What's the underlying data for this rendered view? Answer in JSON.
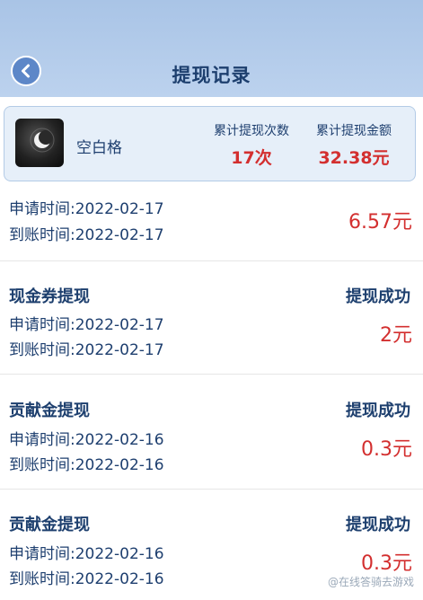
{
  "header": {
    "title": "提现记录"
  },
  "summary": {
    "username": "空白格",
    "count_label": "累计提现次数",
    "count_value": "17次",
    "amount_label": "累计提现金额",
    "amount_value": "32.38元"
  },
  "records": [
    {
      "type": "",
      "status": "",
      "apply": "申请时间:2022-02-17",
      "arrive": "到账时间:2022-02-17",
      "amount": "6.57元"
    },
    {
      "type": "现金券提现",
      "status": "提现成功",
      "apply": "申请时间:2022-02-17",
      "arrive": "到账时间:2022-02-17",
      "amount": "2元"
    },
    {
      "type": "贡献金提现",
      "status": "提现成功",
      "apply": "申请时间:2022-02-16",
      "arrive": "到账时间:2022-02-16",
      "amount": "0.3元"
    },
    {
      "type": "贡献金提现",
      "status": "提现成功",
      "apply": "申请时间:2022-02-16",
      "arrive": "到账时间:2022-02-16",
      "amount": "0.3元"
    }
  ],
  "watermark": "@在线答骑去游戏",
  "icons": {
    "back": "chevron-left-icon",
    "avatar": "moon-night-avatar"
  },
  "colors": {
    "header_bg": "#bcd2ee",
    "title": "#1d3f6e",
    "amount": "#d32f2f"
  }
}
